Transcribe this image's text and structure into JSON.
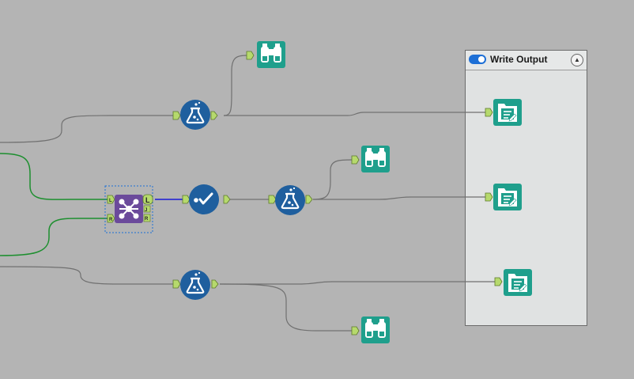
{
  "container": {
    "title": "Write Output",
    "enabled": true,
    "collapse_icon": "chevron-up-icon"
  },
  "join_tool": {
    "input_labels": [
      "L",
      "R"
    ],
    "output_labels": [
      "L",
      "J",
      "R"
    ]
  },
  "colors": {
    "canvas_background": "#b4b4b4",
    "formula_tool": "#1f5f9e",
    "browse_tool": "#1f9f8c",
    "output_tool": "#1f9f8c",
    "join_tool": "#6b4a9b",
    "selection_connection": "#1a1ad6",
    "green_connection": "#1d8f2f",
    "connection": "#707070",
    "anchor": "#b6d96d"
  },
  "icons": [
    "formula-icon",
    "browse-icon",
    "output-icon",
    "join-icon",
    "select-icon"
  ]
}
